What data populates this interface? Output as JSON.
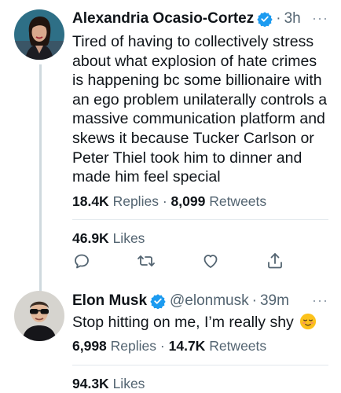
{
  "tweets": [
    {
      "author_name": "Alexandria Ocasio-Cortez",
      "verified": true,
      "time": "3h",
      "text": "Tired of having to collectively stress about what explosion of hate crimes is happening bc some billionaire with an ego problem unilaterally controls a massive communication platform and skews it because Tucker Carlson or Peter Thiel took him to dinner and made him feel special",
      "replies_count": "18.4K",
      "replies_label": "Replies",
      "retweets_count": "8,099",
      "retweets_label": "Retweets",
      "likes_count": "46.9K",
      "likes_label": "Likes",
      "more_icon": "more-icon"
    },
    {
      "author_name": "Elon Musk",
      "verified": true,
      "handle": "@elonmusk",
      "time": "39m",
      "text": "Stop hitting on me, I’m really shy",
      "emoji": "relieved-face-emoji",
      "replies_count": "6,998",
      "replies_label": "Replies",
      "retweets_count": "14.7K",
      "retweets_label": "Retweets",
      "likes_count": "94.3K",
      "likes_label": "Likes"
    }
  ],
  "separator": "·",
  "more_glyph": "···",
  "action_icons": [
    "reply-icon",
    "retweet-icon",
    "like-icon",
    "share-icon"
  ],
  "colors": {
    "verified_blue": "#1d9bf0",
    "secondary_text": "#536471",
    "divider": "#e1e8ed",
    "thread_line": "#cfd9de"
  }
}
